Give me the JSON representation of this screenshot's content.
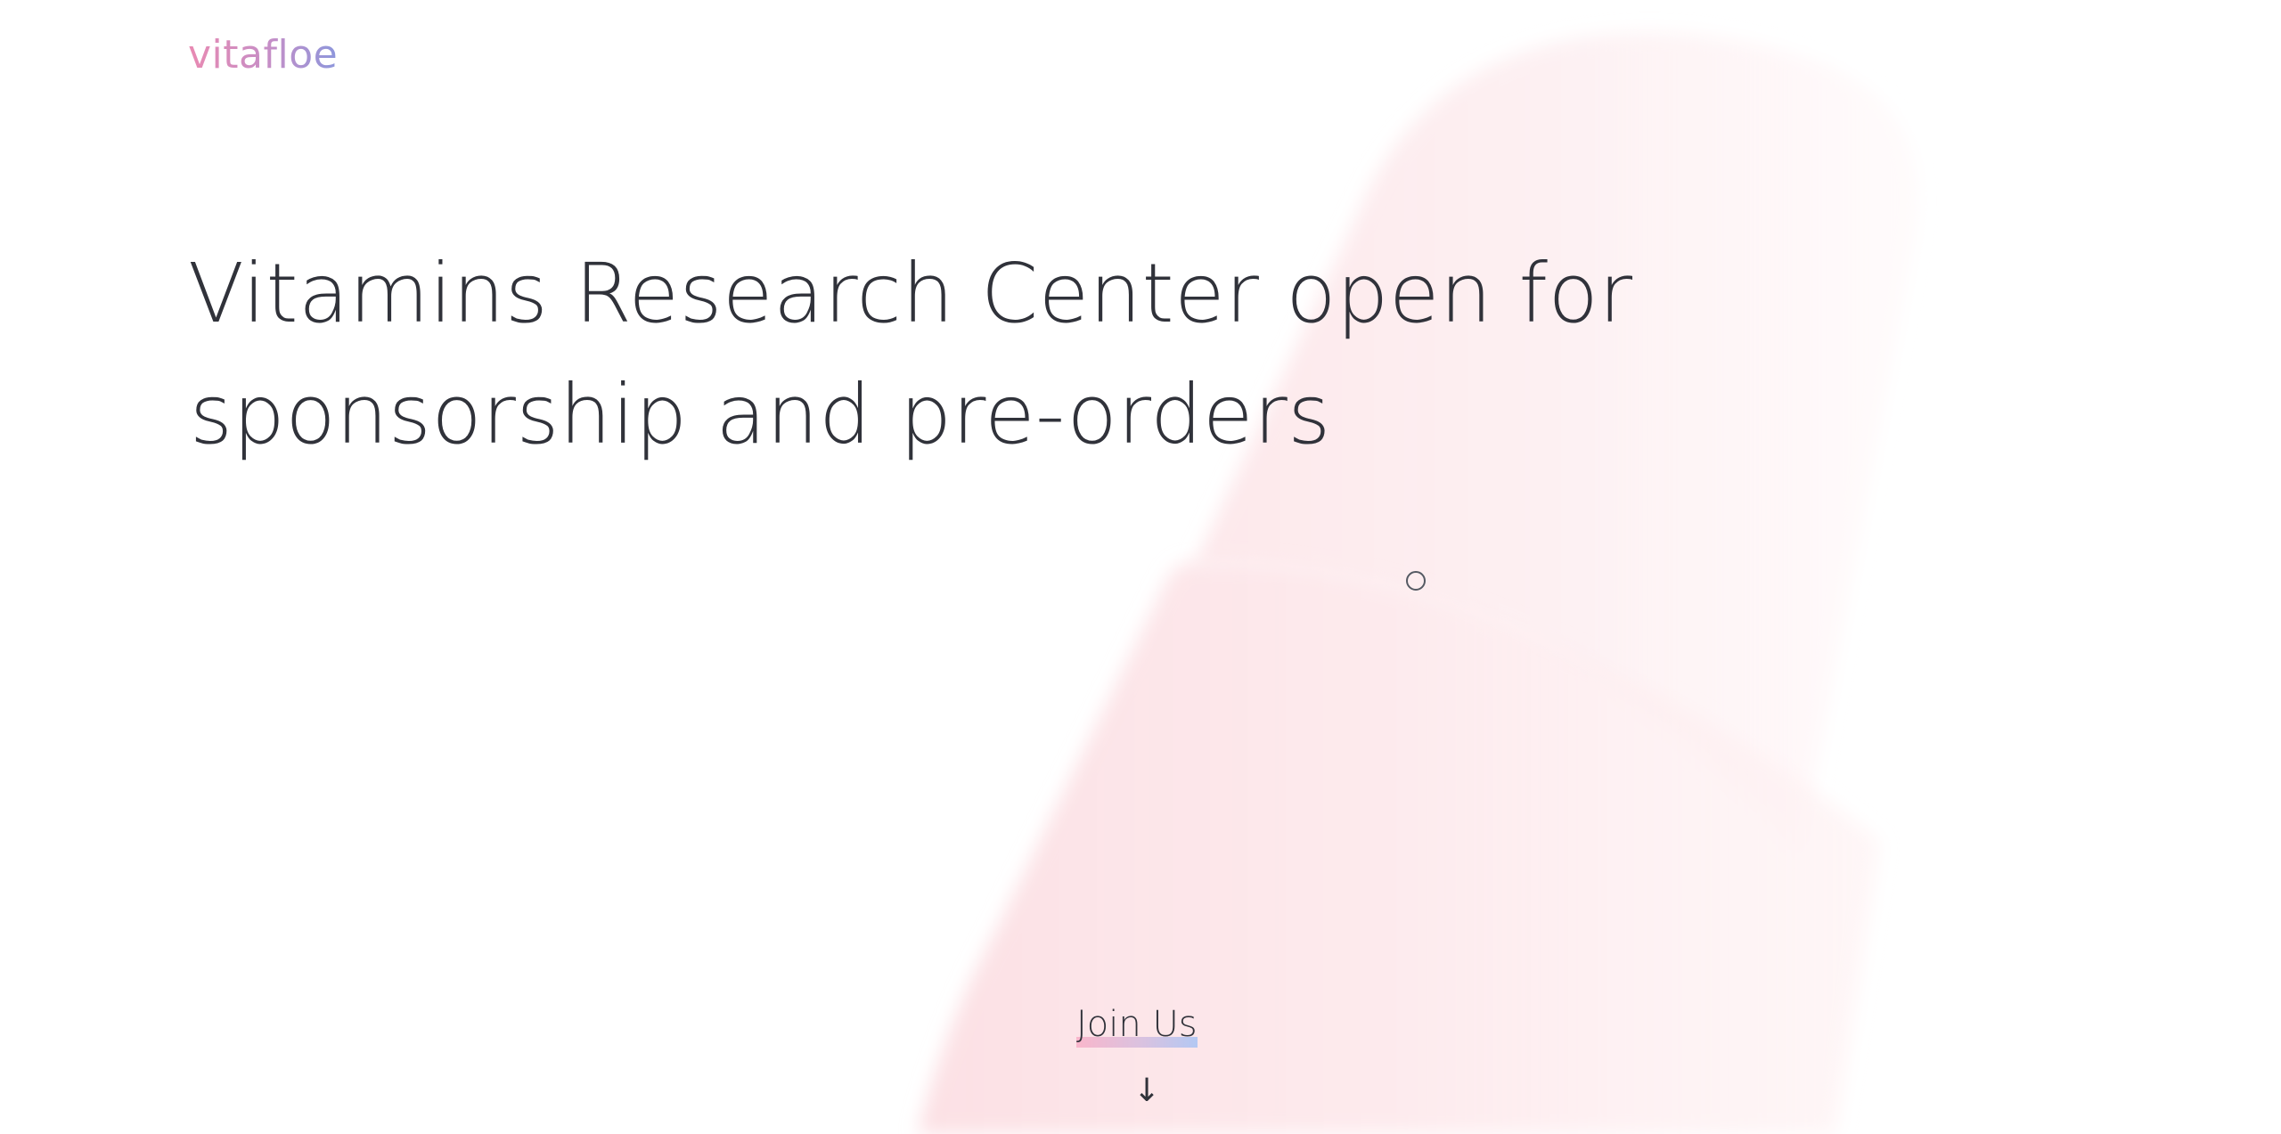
{
  "header": {
    "logo_text": "vitafloe"
  },
  "hero": {
    "headline_line1": "Vitamins Research Center open for",
    "headline_word_highlight1": "sponsorship",
    "headline_connector": " and ",
    "headline_word_highlight2": "pre-orders"
  },
  "cta": {
    "join_label": "Join Us",
    "arrow_glyph": "↓"
  },
  "colors": {
    "text": "#30323a",
    "gradient_pink": "#f9b6cb",
    "gradient_blue": "#b3c8f3",
    "logo_pink": "#e98ab2",
    "logo_blue": "#8d97dc",
    "capsule_tint": "#fde8ea"
  },
  "icons": {
    "cursor": "cursor-ring-icon",
    "scroll": "arrow-down-icon"
  }
}
